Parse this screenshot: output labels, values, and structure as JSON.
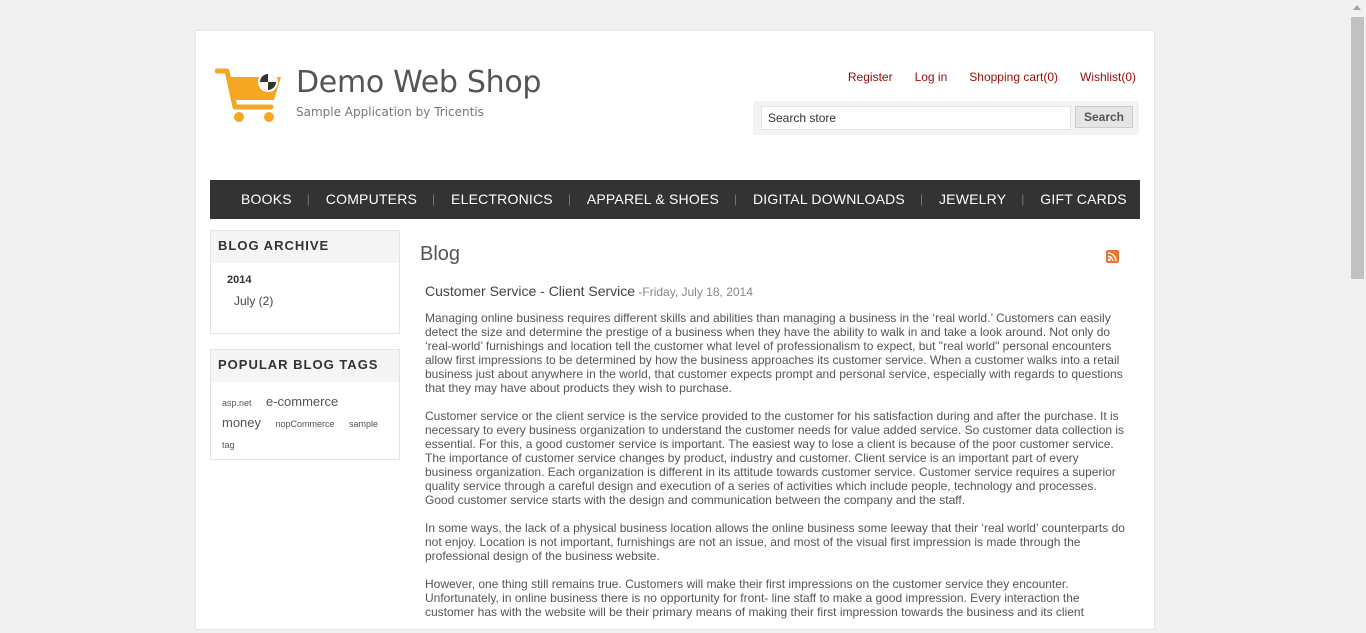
{
  "header": {
    "title": "Demo Web Shop",
    "subtitle": "Sample Application by Tricentis",
    "links": {
      "register": "Register",
      "login": "Log in",
      "cart": "Shopping cart(0)",
      "wishlist": "Wishlist(0)"
    },
    "search": {
      "value": "Search store",
      "button": "Search"
    },
    "logo_color": "#f5a623"
  },
  "nav": {
    "items": [
      "BOOKS",
      "COMPUTERS",
      "ELECTRONICS",
      "APPAREL & SHOES",
      "DIGITAL DOWNLOADS",
      "JEWELRY",
      "GIFT CARDS"
    ]
  },
  "sidebar": {
    "archive": {
      "title": "BLOG ARCHIVE",
      "year": "2014",
      "month": "July (2)"
    },
    "tags": {
      "title": "POPULAR BLOG TAGS",
      "items": [
        "asp.net",
        "e-commerce",
        "money",
        "nopCommerce",
        "sample",
        "tag"
      ]
    }
  },
  "main": {
    "title": "Blog",
    "rss_icon": "rss-icon",
    "post": {
      "title": "Customer Service - Client Service",
      "date": " -Friday, July 18, 2014",
      "paragraphs": [
        "Managing online business requires different skills and abilities than managing a business in the ‘real world.’ Customers can easily detect the size and determine the prestige of a business when they have the ability to walk in and take a look around. Not only do ‘real-world’ furnishings and location tell the customer what level of professionalism to expect, but \"real world\" personal encounters allow first impressions to be determined by how the business approaches its customer service. When a customer walks into a retail business just about anywhere in the world, that customer expects prompt and personal service, especially with regards to questions that they may have about products they wish to purchase.",
        "Customer service or the client service is the service provided to the customer for his satisfaction during and after the purchase. It is necessary to every business organization to understand the customer needs for value added service. So customer data collection is essential. For this, a good customer service is important. The easiest way to lose a client is because of the poor customer service. The importance of customer service changes by product, industry and customer. Client service is an important part of every business organization. Each organization is different in its attitude towards customer service. Customer service requires a superior quality service through a careful design and execution of a series of activities which include people, technology and processes. Good customer service starts with the design and communication between the company and the staff.",
        "In some ways, the lack of a physical business location allows the online business some leeway that their ‘real world’ counterparts do not enjoy. Location is not important, furnishings are not an issue, and most of the visual first impression is made through the professional design of the business website.",
        "However, one thing still remains true. Customers will make their first impressions on the customer service they encounter. Unfortunately, in online business there is no opportunity for front- line staff to make a good impression. Every interaction the customer has with the website will be their primary means of making their first impression towards the business and its client"
      ]
    }
  }
}
